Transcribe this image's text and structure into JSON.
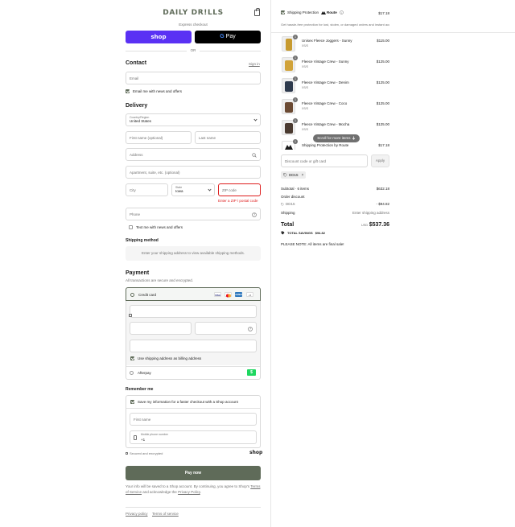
{
  "brand": {
    "logo": "DAILY DR!LLS",
    "accent": "#5f6b59",
    "shop_purple": "#5a31f4",
    "error": "#dd1d1d"
  },
  "express": {
    "title": "Express checkout",
    "shop_label": "shop",
    "gpay_g": "G",
    "gpay_label": "Pay",
    "or_label": "OR"
  },
  "contact": {
    "title": "Contact",
    "signin_label": "Sign in",
    "email_placeholder": "Email",
    "news_label": "Email me with news and offers"
  },
  "delivery": {
    "title": "Delivery",
    "country_label": "Country/Region",
    "country_value": "United States",
    "first_name_placeholder": "First name (optional)",
    "last_name_placeholder": "Last name",
    "address_placeholder": "Address",
    "apartment_placeholder": "Apartment, suite, etc. (optional)",
    "city_placeholder": "City",
    "state_label": "State",
    "state_value": "Iowa",
    "zip_placeholder": "ZIP code",
    "zip_error": "Enter a ZIP / postal code",
    "phone_placeholder": "Phone",
    "text_news_label": "Text me with news and offers"
  },
  "shipping_method": {
    "title": "Shipping method",
    "info": "Enter your shipping address to view available shipping methods."
  },
  "payment": {
    "title": "Payment",
    "subtitle": "All transactions are secure and encrypted.",
    "credit_card_label": "Credit card",
    "card_logos": [
      "VISA",
      "MC",
      "AMEX"
    ],
    "more_cards": "+5",
    "billing_label": "Use shipping address as billing address",
    "afterpay_label": "Afterpay",
    "afterpay_logo": "$"
  },
  "remember": {
    "title": "Remember me",
    "save_label": "Save my information for a faster checkout with a Shop account",
    "first_name_placeholder": "First name",
    "mobile_label": "Mobile phone number",
    "mobile_value": "+1",
    "secure_label": "Secured and encrypted",
    "shop_logo": "shop"
  },
  "pay_now_label": "Pay now",
  "legal": {
    "text_prefix": "Your info will be saved to a Shop account. By continuing, you agree to Shop's",
    "terms_label": "Terms of Service",
    "text_mid": "and acknowledge the",
    "privacy_label": "Privacy Policy",
    "text_end": "."
  },
  "footer": {
    "privacy_link": "Privacy policy",
    "terms_link": "Terms of service"
  },
  "summary": {
    "protection_label": "Shipping Protection",
    "route_label": "Route",
    "protection_price": "$17.18",
    "protection_note": "Get hassle-free protection for lost, stolen, or damaged orders and instant access to self-serve replacements and refunds",
    "items": [
      {
        "qty": "1",
        "name": "Unisex Fleece Joggers - Sunny",
        "variant": "XS/S",
        "price": "$115.00",
        "color": "#c79a2e"
      },
      {
        "qty": "1",
        "name": "Fleece Vintage Crew - Sunny",
        "variant": "XS/S",
        "price": "$125.00",
        "color": "#d1a33a"
      },
      {
        "qty": "1",
        "name": "Fleece Vintage Crew - Denim",
        "variant": "XS/S",
        "price": "$125.00",
        "color": "#2e3a4d"
      },
      {
        "qty": "1",
        "name": "Fleece Vintage Crew - Coco",
        "variant": "XS/S",
        "price": "$125.00",
        "color": "#6b4a33"
      },
      {
        "qty": "1",
        "name": "Fleece Vintage Crew - Mocha",
        "variant": "XS/S",
        "price": "$125.00",
        "color": "#4a3a30"
      },
      {
        "qty": "1",
        "name": "Shipping Protection by Route",
        "variant": "",
        "price": "$17.18",
        "color": "#ffffff"
      }
    ],
    "scroll_hint": "Scroll for more items",
    "discount_placeholder": "Discount code or gift card",
    "apply_label": "Apply",
    "applied_code": "DD15",
    "subtotal_label": "Subtotal · 6 items",
    "subtotal_value": "$632.18",
    "order_discount_label": "Order discount",
    "discount_code": "DD15",
    "discount_value": "- $94.82",
    "shipping_label": "Shipping",
    "shipping_value": "Enter shipping address",
    "total_label": "Total",
    "currency": "USD",
    "total_value": "$537.36",
    "savings_label": "TOTAL SAVINGS",
    "savings_value": "$94.82",
    "note": "PLEASE NOTE: All items are final sale!"
  }
}
